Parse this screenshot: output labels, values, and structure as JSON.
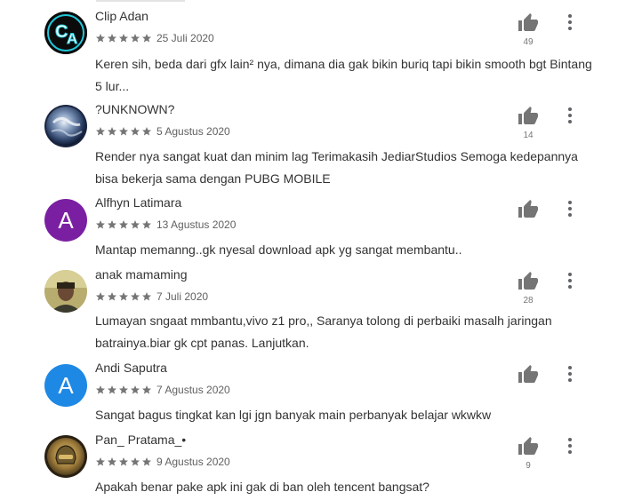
{
  "colors": {
    "star": "#757575",
    "thumb": "#757575",
    "purple": "#7b1fa2",
    "blue": "#1e88e5"
  },
  "icons": {
    "thumb": "thumbs-up-icon",
    "more": "more-vert-icon",
    "star": "star-icon"
  },
  "reviews": [
    {
      "author": "Clip Adan",
      "rating": 5,
      "date": "25 Juli 2020",
      "body": "Keren sih, beda dari gfx lain² nya, dimana dia gak bikin buriq tapi bikin smooth bgt Bintang 5 lur...",
      "helpful": "49",
      "avatar": {
        "type": "logo",
        "text": "CA"
      }
    },
    {
      "author": "?UNKNOWN?",
      "rating": 5,
      "date": "5 Agustus 2020",
      "body": "Render nya sangat kuat dan minim lag Terimakasih JediarStudios Semoga kedepannya bisa bekerja sama dengan PUBG MOBILE",
      "helpful": "14",
      "avatar": {
        "type": "photo"
      }
    },
    {
      "author": "Alfhyn Latimara",
      "rating": 5,
      "date": "13 Agustus 2020",
      "body": "Mantap memanng..gk nyesal download apk yg sangat membantu..",
      "helpful": "",
      "avatar": {
        "type": "letter",
        "letter": "A",
        "color": "#7b1fa2"
      }
    },
    {
      "author": "anak mamaming",
      "rating": 5,
      "date": "7 Juli 2020",
      "body": "Lumayan sngaat mmbantu,vivo z1 pro,, Saranya tolong di perbaiki masalh jaringan batrainya.biar gk cpt panas. Lanjutkan.",
      "helpful": "28",
      "avatar": {
        "type": "photo"
      }
    },
    {
      "author": "Andi Saputra",
      "rating": 5,
      "date": "7 Agustus 2020",
      "body": "Sangat bagus tingkat kan lgi jgn banyak main perbanyak belajar wkwkw",
      "helpful": "",
      "avatar": {
        "type": "letter",
        "letter": "A",
        "color": "#1e88e5"
      }
    },
    {
      "author": "Pan_ Pratama_•",
      "rating": 5,
      "date": "9 Agustus 2020",
      "body": "Apakah benar pake apk ini gak di ban oleh tencent bangsat?",
      "helpful": "9",
      "avatar": {
        "type": "photo"
      }
    }
  ]
}
